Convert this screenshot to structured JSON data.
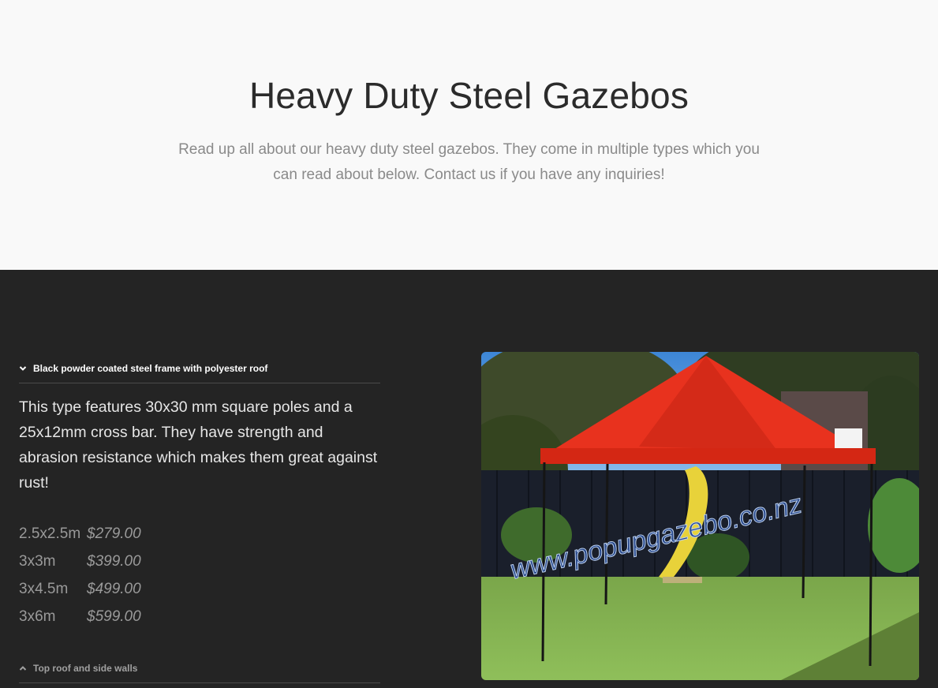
{
  "hero": {
    "title": "Heavy Duty Steel Gazebos",
    "subtitle": "Read up all about our heavy duty steel gazebos. They come in multiple types which you can read about below. Contact us if you have any inquiries!"
  },
  "accordion": {
    "first": {
      "title": "Black powder coated steel frame with polyester roof",
      "icon": "chevron-down-icon",
      "description": "This type features 30x30 mm square poles and a 25x12mm cross bar. They have strength and abrasion resistance which makes them great against rust!",
      "prices": [
        {
          "size": "2.5x2.5m",
          "price": "$279.00"
        },
        {
          "size": "3x3m",
          "price": "$399.00"
        },
        {
          "size": "3x4.5m",
          "price": "$499.00"
        },
        {
          "size": "3x6m",
          "price": "$599.00"
        }
      ]
    },
    "second": {
      "title": "Top roof and side walls",
      "icon": "chevron-up-icon"
    }
  },
  "photo": {
    "watermark": "www.popupgazebo.co.nz"
  },
  "colors": {
    "hero_bg": "#f9f9f9",
    "dark_bg": "#242424",
    "canopy": "#e8321e"
  }
}
